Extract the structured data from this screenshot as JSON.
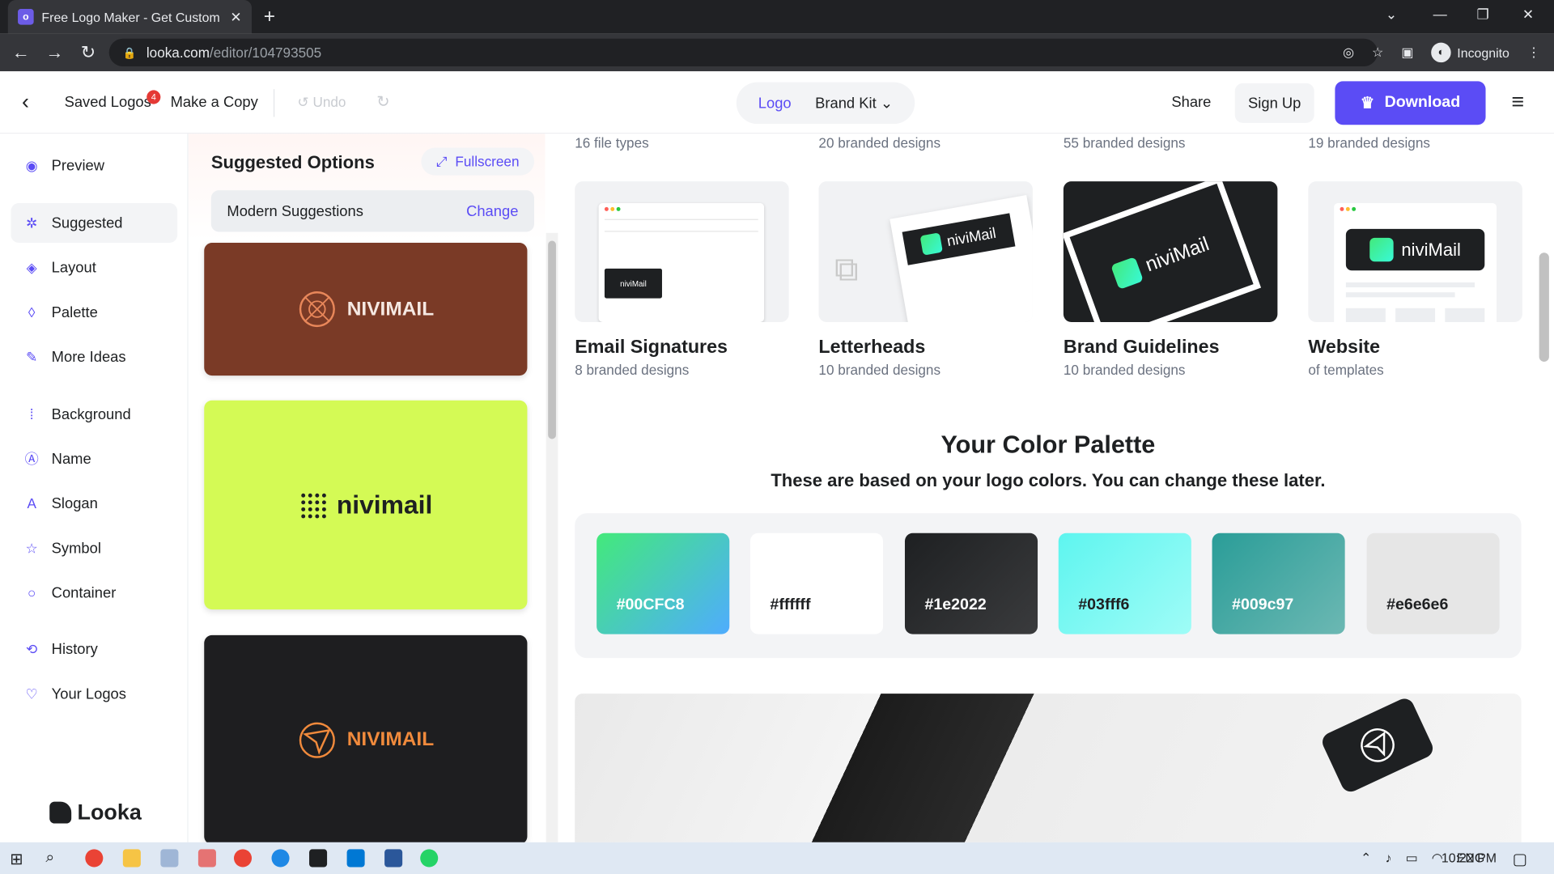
{
  "browser": {
    "tab_title": "Free Logo Maker - Get Custom Lo",
    "url_host": "looka.com",
    "url_path": "/editor/104793505",
    "profile_label": "Incognito"
  },
  "header": {
    "saved_logos": "Saved Logos",
    "saved_badge": "4",
    "make_copy": "Make a Copy",
    "undo": "Undo",
    "tab_logo": "Logo",
    "tab_brand_kit": "Brand Kit",
    "share": "Share",
    "sign_up": "Sign Up",
    "download": "Download"
  },
  "sidebar": {
    "items": [
      {
        "label": "Preview",
        "icon": "eye-icon"
      },
      {
        "label": "Suggested",
        "icon": "sparkle-icon"
      },
      {
        "label": "Layout",
        "icon": "layers-icon"
      },
      {
        "label": "Palette",
        "icon": "drop-icon"
      },
      {
        "label": "More Ideas",
        "icon": "wand-icon"
      },
      {
        "label": "Background",
        "icon": "grid-icon"
      },
      {
        "label": "Name",
        "icon": "text-box-icon"
      },
      {
        "label": "Slogan",
        "icon": "font-icon"
      },
      {
        "label": "Symbol",
        "icon": "star-icon"
      },
      {
        "label": "Container",
        "icon": "circle-icon"
      },
      {
        "label": "History",
        "icon": "history-icon"
      },
      {
        "label": "Your Logos",
        "icon": "heart-icon"
      }
    ],
    "brand": "Looka"
  },
  "suggestions": {
    "title": "Suggested Options",
    "fullscreen": "Fullscreen",
    "style_label": "Modern Suggestions",
    "change": "Change",
    "cards": [
      "NIVIMAIL",
      "nivimail",
      "NIVIMAIL"
    ]
  },
  "main": {
    "top_subs": [
      "16 file types",
      "20 branded designs",
      "55 branded designs",
      "19 branded designs"
    ],
    "categories": [
      {
        "title": "Email Signatures",
        "sub": "8 branded designs"
      },
      {
        "title": "Letterheads",
        "sub": "10 branded designs"
      },
      {
        "title": "Brand Guidelines",
        "sub": "10 branded designs"
      },
      {
        "title": "Website",
        "sub": "of templates"
      }
    ],
    "thumb_brand": "niviMail",
    "palette_title": "Your Color Palette",
    "palette_sub": "These are based on your logo colors. You can change these later.",
    "swatches": [
      {
        "label": "#00CFC8",
        "color": "#00CFC8"
      },
      {
        "label": "#ffffff",
        "color": "#ffffff"
      },
      {
        "label": "#1e2022",
        "color": "#1e2022"
      },
      {
        "label": "#03fff6",
        "color": "#03fff6"
      },
      {
        "label": "#009c97",
        "color": "#009c97"
      },
      {
        "label": "#e6e6e6",
        "color": "#e6e6e6"
      }
    ]
  },
  "taskbar": {
    "lang": "ENG",
    "time": "10:22 PM"
  }
}
